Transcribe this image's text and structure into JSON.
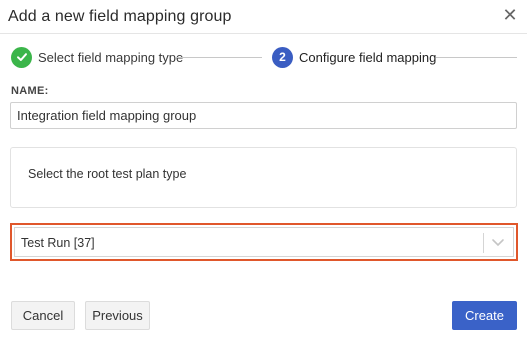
{
  "dialog": {
    "title": "Add a new field mapping group",
    "close_icon": "close-icon"
  },
  "stepper": {
    "steps": [
      {
        "label": "Select field mapping type",
        "status": "complete",
        "icon": "checkmark-icon"
      },
      {
        "label": "Configure field mapping",
        "status": "active",
        "number": "2"
      }
    ]
  },
  "form": {
    "name_label": "NAME:",
    "name_value": "Integration field mapping group",
    "prompt": "Select the root test plan type",
    "select_value": "Test Run [37]",
    "select_icon": "chevron-down-icon"
  },
  "buttons": {
    "cancel": "Cancel",
    "previous": "Previous",
    "create": "Create"
  },
  "colors": {
    "complete": "#3bb54a",
    "active": "#3a5dc2",
    "highlight": "#e0572b",
    "primary": "#3a62c8"
  }
}
